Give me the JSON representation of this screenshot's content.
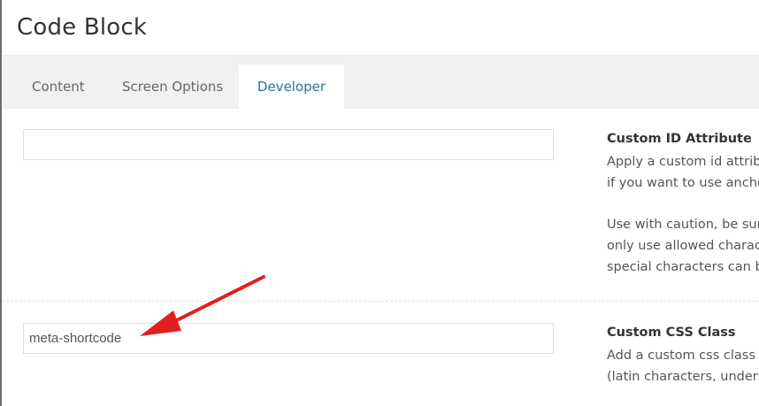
{
  "window": {
    "title": "Code Block"
  },
  "tabs": [
    {
      "label": "Content",
      "active": false
    },
    {
      "label": "Screen Options",
      "active": false
    },
    {
      "label": "Developer",
      "active": true
    }
  ],
  "fields": {
    "custom_id": {
      "label": "Custom ID Attribute",
      "value": "",
      "description_lines": [
        "Apply a custom id attrib",
        "if you want to use ancho",
        "",
        "Use with caution, be sur",
        "only use allowed charact",
        "special characters can be"
      ]
    },
    "custom_css": {
      "label": "Custom CSS Class",
      "value": "meta-shortcode",
      "description_lines": [
        "Add a custom css class f",
        "(latin characters, unders"
      ]
    }
  },
  "annotation": {
    "arrow_color": "#e02020"
  },
  "colors": {
    "active_tab_text": "#21759b",
    "tabbar_bg": "#f1f1f1"
  }
}
